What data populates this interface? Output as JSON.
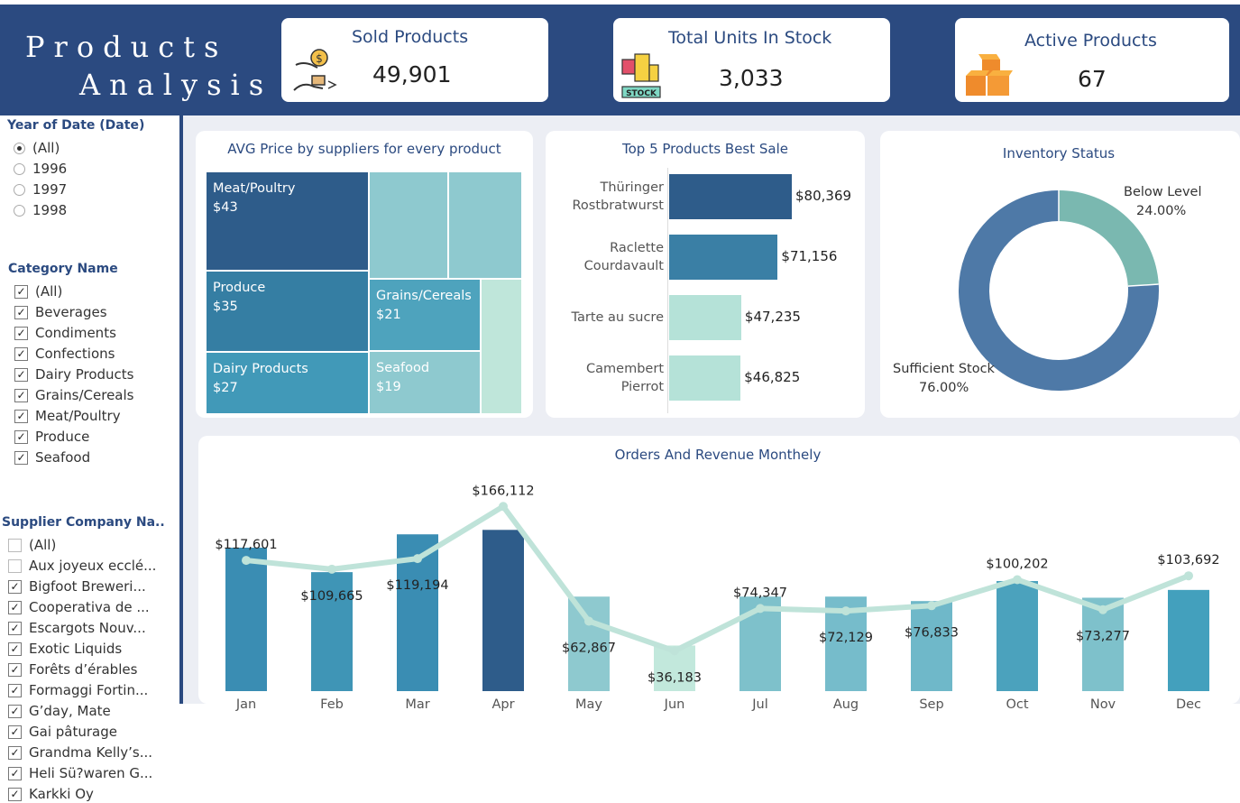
{
  "header": {
    "title_line1": "Products",
    "title_line2": "Analysis",
    "bg_color": "#2b4a80"
  },
  "kpis": {
    "sold": {
      "label": "Sold Products",
      "value": "49,901",
      "icon": "money-exchange-icon"
    },
    "stock": {
      "label": "Total Units In Stock",
      "value": "3,033",
      "icon": "stock-cart-icon"
    },
    "active": {
      "label": "Active Products",
      "value": "67",
      "icon": "boxes-icon"
    }
  },
  "filters": {
    "year": {
      "title": "Year of Date (Date)",
      "options": [
        "(All)",
        "1996",
        "1997",
        "1998"
      ],
      "selected": "(All)"
    },
    "category": {
      "title": "Category Name",
      "items": [
        "(All)",
        "Beverages",
        "Condiments",
        "Confections",
        "Dairy Products",
        "Grains/Cereals",
        "Meat/Poultry",
        "Produce",
        "Seafood"
      ]
    },
    "supplier": {
      "title": "Supplier Company Na..",
      "items": [
        "(All)",
        "Aux joyeux ecclé...",
        "Bigfoot Breweri...",
        "Cooperativa de ...",
        "Escargots Nouv...",
        "Exotic Liquids",
        "Forêts d’érables",
        "Formaggi Fortin...",
        "G’day, Mate",
        "Gai pâturage",
        "Grandma Kelly’s...",
        "Heli Sü?waren G...",
        "Karkki Oy"
      ],
      "unchecked": [
        "(All)",
        "Aux joyeux ecclé..."
      ]
    }
  },
  "treemap": {
    "title": "AVG Price by suppliers for every product",
    "tiles": [
      {
        "label": "Meat/Poultry",
        "value": "$43"
      },
      {
        "label": "Produce",
        "value": "$35"
      },
      {
        "label": "Dairy Products",
        "value": "$27"
      },
      {
        "label": "Grains/Cereals",
        "value": "$21"
      },
      {
        "label": "Seafood",
        "value": "$19"
      }
    ]
  },
  "top5": {
    "title": "Top 5 Products Best Sale",
    "items": [
      {
        "name": "Thüringer Rostbratwurst",
        "value": 80369,
        "label": "$80,369",
        "color": "#2e5c8a"
      },
      {
        "name": "Raclette Courdavault",
        "value": 71156,
        "label": "$71,156",
        "color": "#3a7fa5"
      },
      {
        "name": "Tarte au sucre",
        "value": 47235,
        "label": "$47,235",
        "color": "#b5e2d8"
      },
      {
        "name": "Camembert Pierrot",
        "value": 46825,
        "label": "$46,825",
        "color": "#b5e2d8"
      }
    ]
  },
  "inventory": {
    "title": "Inventory Status",
    "segments": [
      {
        "name": "Below Level",
        "pct": 24.0,
        "label": "24.00%",
        "color": "#7ab8b0"
      },
      {
        "name": "Sufficient Stock",
        "pct": 76.0,
        "label": "76.00%",
        "color": "#4e79a7"
      }
    ]
  },
  "chart_data": {
    "type": "bar",
    "title": "Orders And Revenue Monthely",
    "categories": [
      "Jan",
      "Feb",
      "Mar",
      "Apr",
      "May",
      "Jun",
      "Jul",
      "Aug",
      "Sep",
      "Oct",
      "Nov",
      "Dec"
    ],
    "series": [
      {
        "type": "bar",
        "values": [
          129000,
          107000,
          141000,
          145000,
          85000,
          41000,
          85000,
          85000,
          81000,
          99000,
          84000,
          91000
        ],
        "colors": [
          "#3a8db3",
          "#3f95b6",
          "#3a8db3",
          "#2e5c8a",
          "#8ec9cf",
          "#c2e8dc",
          "#7ec1cb",
          "#76bccb",
          "#6fb8c9",
          "#4ba2bd",
          "#7ec1cb",
          "#43a0bd"
        ]
      },
      {
        "type": "line",
        "values": [
          117601,
          109665,
          119194,
          166112,
          62867,
          36183,
          74347,
          72129,
          76833,
          100202,
          73277,
          103692
        ],
        "labels": [
          "$117,601",
          "$109,665",
          "$119,194",
          "$166,112",
          "$62,867",
          "$36,183",
          "$74,347",
          "$72,129",
          "$76,833",
          "$100,202",
          "$73,277",
          "$103,692"
        ],
        "color": "#bfe3d9"
      }
    ],
    "ylim": [
      0,
      185000
    ]
  }
}
